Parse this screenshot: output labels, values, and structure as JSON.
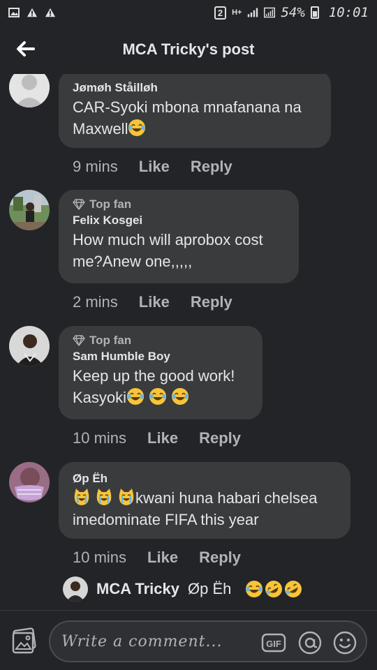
{
  "status_bar": {
    "sim_badge": "2",
    "network": "H+",
    "battery": "54%",
    "battery_level": 0.54,
    "time": "10:01"
  },
  "header": {
    "title": "MCA Tricky's post"
  },
  "comments": [
    {
      "author": "Jømøh Ståilløh",
      "top_fan": "",
      "lines": [
        "CAR-Syoki mbona mnafanana na",
        "Maxwell"
      ],
      "emoji_after": [
        "laugh-tears"
      ],
      "time": "9 mins",
      "like": "Like",
      "reply": "Reply"
    },
    {
      "author": "Felix Kosgei",
      "top_fan": "Top fan",
      "lines": [
        "How much will aprobox cost",
        "me?Anew one,,,,,"
      ],
      "time": "2 mins",
      "like": "Like",
      "reply": "Reply"
    },
    {
      "author": "Sam Humble Boy",
      "top_fan": "Top fan",
      "lines": [
        "Keep up the good work!",
        "Kasyoki"
      ],
      "emoji_after": [
        "laugh-tears",
        "laugh-tears",
        "laugh-tears"
      ],
      "time": "10 mins",
      "like": "Like",
      "reply": "Reply"
    },
    {
      "author": "Øp Ëh",
      "top_fan": "",
      "lines": [
        "kwani huna habari chelsea",
        "imedominate FIFA this year"
      ],
      "emoji_before": [
        "cat-tears",
        "cat-tears",
        "cat-tears"
      ],
      "time": "10 mins",
      "like": "Like",
      "reply": "Reply"
    }
  ],
  "reply_preview": {
    "name": "MCA Tricky",
    "text": "Øp Ëh",
    "emojis": [
      "laugh-tears",
      "rofl",
      "rofl"
    ]
  },
  "composer": {
    "placeholder": "Write a comment...",
    "gif_label": "GIF"
  },
  "colors": {
    "background": "#232427",
    "bubble": "#3a3b3c",
    "text": "#e4e6eb",
    "muted": "#b0b3b8"
  }
}
